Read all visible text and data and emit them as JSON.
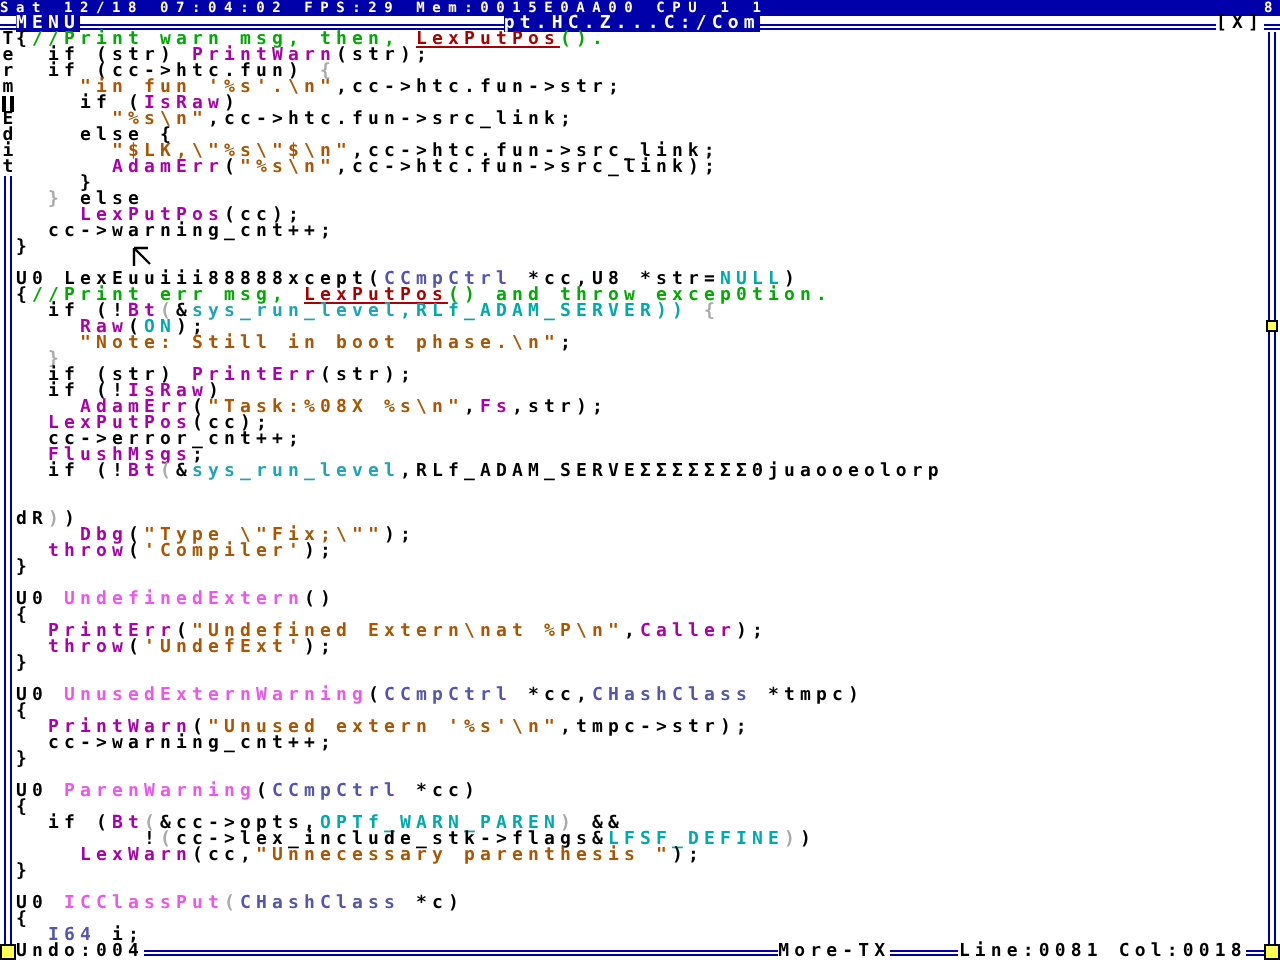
{
  "status_bar": {
    "text": "Sat 12/18 07:04:02 FPS:29 Mem:0015E0AA00 CPU 1 1",
    "corner": "8"
  },
  "window": {
    "menu": "MENU",
    "title": "pt.HC.Z...C:/Com",
    "close": "[X]"
  },
  "side_labels": [
    "Term",
    "Edit"
  ],
  "lines": [
    {
      "kind": "code",
      "tokens": [
        {
          "kind": "plain",
          "text": "{"
        },
        {
          "kind": "comment",
          "text": "//Print warn msg, then, "
        },
        {
          "kind": "link",
          "text": "LexPutPos"
        },
        {
          "kind": "comment",
          "text": "()."
        }
      ]
    },
    {
      "kind": "code",
      "tokens": [
        {
          "kind": "plain",
          "text": "  if (str) "
        },
        {
          "kind": "func",
          "text": "PrintWarn"
        },
        {
          "kind": "plain",
          "text": "(str);"
        }
      ]
    },
    {
      "kind": "code",
      "tokens": [
        {
          "kind": "plain",
          "text": "  if (cc->htc.fun) "
        },
        {
          "kind": "dim",
          "text": "{"
        }
      ]
    },
    {
      "kind": "code",
      "tokens": [
        {
          "kind": "string",
          "text": "    \"in fun '%s'.\\n\""
        },
        {
          "kind": "plain",
          "text": ",cc->htc.fun->str;"
        }
      ]
    },
    {
      "kind": "code",
      "tokens": [
        {
          "kind": "plain",
          "text": "    if ("
        },
        {
          "kind": "func",
          "text": "IsRaw"
        },
        {
          "kind": "plain",
          "text": ")"
        }
      ]
    },
    {
      "kind": "code",
      "tokens": [
        {
          "kind": "string",
          "text": "      \"%s\\n\""
        },
        {
          "kind": "plain",
          "text": ",cc->htc.fun->src_link;"
        }
      ]
    },
    {
      "kind": "code",
      "tokens": [
        {
          "kind": "plain",
          "text": "    else {"
        }
      ]
    },
    {
      "kind": "code",
      "tokens": [
        {
          "kind": "string",
          "text": "      \"$LK,\\\"%s\\\"$\\n\""
        },
        {
          "kind": "plain",
          "text": ",cc->htc.fun->src_link;"
        }
      ]
    },
    {
      "kind": "code",
      "tokens": [
        {
          "kind": "func",
          "text": "      AdamErr"
        },
        {
          "kind": "plain",
          "text": "("
        },
        {
          "kind": "string",
          "text": "\"%s\\n\""
        },
        {
          "kind": "plain",
          "text": ",cc->htc.fun->src_link);"
        }
      ]
    },
    {
      "kind": "code",
      "tokens": [
        {
          "kind": "plain",
          "text": "    }"
        }
      ]
    },
    {
      "kind": "code",
      "tokens": [
        {
          "kind": "dim",
          "text": "  }"
        },
        {
          "kind": "plain",
          "text": " else"
        }
      ]
    },
    {
      "kind": "code",
      "tokens": [
        {
          "kind": "func",
          "text": "    LexPutPos"
        },
        {
          "kind": "plain",
          "text": "(cc);"
        }
      ]
    },
    {
      "kind": "code",
      "tokens": [
        {
          "kind": "plain",
          "text": "  cc->warning_cnt++;"
        }
      ]
    },
    {
      "kind": "code",
      "tokens": [
        {
          "kind": "plain",
          "text": "}"
        }
      ]
    },
    {
      "kind": "blank"
    },
    {
      "kind": "code",
      "tokens": [
        {
          "kind": "plain",
          "text": "U0 LexEuuiii88888xcept("
        },
        {
          "kind": "type",
          "text": "CCmpCtrl"
        },
        {
          "kind": "plain",
          "text": " *cc,U8 *str="
        },
        {
          "kind": "const",
          "text": "NULL"
        },
        {
          "kind": "plain",
          "text": ")"
        }
      ]
    },
    {
      "kind": "code",
      "tokens": [
        {
          "kind": "plain",
          "text": "{"
        },
        {
          "kind": "comment",
          "text": "//Print err msg, "
        },
        {
          "kind": "link",
          "text": "LexPutPos"
        },
        {
          "kind": "comment",
          "text": "() and throw excep0tion."
        }
      ]
    },
    {
      "kind": "code",
      "tokens": [
        {
          "kind": "plain",
          "text": "  if (!"
        },
        {
          "kind": "func",
          "text": "Bt"
        },
        {
          "kind": "dim",
          "text": "("
        },
        {
          "kind": "plain",
          "text": "&"
        },
        {
          "kind": "global",
          "text": "sys_run_level"
        },
        {
          "kind": "const",
          "text": ",RLf_ADAM_SERVER))"
        },
        {
          "kind": "dim",
          "text": " {"
        }
      ]
    },
    {
      "kind": "code",
      "tokens": [
        {
          "kind": "func",
          "text": "    Raw"
        },
        {
          "kind": "plain",
          "text": "("
        },
        {
          "kind": "const",
          "text": "ON"
        },
        {
          "kind": "plain",
          "text": ");"
        }
      ]
    },
    {
      "kind": "code",
      "tokens": [
        {
          "kind": "string",
          "text": "    \"Note: Still in boot phase.\\n\""
        },
        {
          "kind": "plain",
          "text": ";"
        }
      ]
    },
    {
      "kind": "code",
      "tokens": [
        {
          "kind": "dim",
          "text": "  }"
        }
      ]
    },
    {
      "kind": "code",
      "tokens": [
        {
          "kind": "plain",
          "text": "  if (str) "
        },
        {
          "kind": "func",
          "text": "PrintErr"
        },
        {
          "kind": "plain",
          "text": "(str);"
        }
      ]
    },
    {
      "kind": "code",
      "tokens": [
        {
          "kind": "plain",
          "text": "  if (!"
        },
        {
          "kind": "func",
          "text": "IsRaw"
        },
        {
          "kind": "plain",
          "text": ")"
        }
      ]
    },
    {
      "kind": "code",
      "tokens": [
        {
          "kind": "func",
          "text": "    AdamErr"
        },
        {
          "kind": "plain",
          "text": "("
        },
        {
          "kind": "string",
          "text": "\"Task:%08X %s\\n\""
        },
        {
          "kind": "plain",
          "text": ","
        },
        {
          "kind": "func",
          "text": "Fs"
        },
        {
          "kind": "plain",
          "text": ",str);"
        }
      ]
    },
    {
      "kind": "code",
      "tokens": [
        {
          "kind": "func",
          "text": "  LexPutPos"
        },
        {
          "kind": "plain",
          "text": "(cc);"
        }
      ]
    },
    {
      "kind": "code",
      "tokens": [
        {
          "kind": "plain",
          "text": "  cc->error_cnt++;"
        }
      ]
    },
    {
      "kind": "code",
      "tokens": [
        {
          "kind": "func",
          "text": "  FlushMsgs"
        },
        {
          "kind": "plain",
          "text": ";"
        }
      ]
    },
    {
      "kind": "code",
      "tokens": [
        {
          "kind": "plain",
          "text": "  if (!"
        },
        {
          "kind": "func",
          "text": "Bt"
        },
        {
          "kind": "dim",
          "text": "("
        },
        {
          "kind": "plain",
          "text": "&"
        },
        {
          "kind": "global",
          "text": "sys_run_level"
        },
        {
          "kind": "plain",
          "text": ",RLf_ADAM_SERVEΣΣΣΣΣΣΣΘjuaooeolorp"
        }
      ]
    },
    {
      "kind": "blank"
    },
    {
      "kind": "blank"
    },
    {
      "kind": "code",
      "tokens": [
        {
          "kind": "plain",
          "text": "dR"
        },
        {
          "kind": "dim",
          "text": ")"
        },
        {
          "kind": "plain",
          "text": ")"
        }
      ]
    },
    {
      "kind": "code",
      "tokens": [
        {
          "kind": "func",
          "text": "    Dbg"
        },
        {
          "kind": "plain",
          "text": "("
        },
        {
          "kind": "string",
          "text": "\"Type \\\"Fix;\\\"\""
        },
        {
          "kind": "plain",
          "text": ");"
        }
      ]
    },
    {
      "kind": "code",
      "tokens": [
        {
          "kind": "func",
          "text": "  throw"
        },
        {
          "kind": "plain",
          "text": "("
        },
        {
          "kind": "string",
          "text": "'Compiler'"
        },
        {
          "kind": "plain",
          "text": ");"
        }
      ]
    },
    {
      "kind": "code",
      "tokens": [
        {
          "kind": "plain",
          "text": "}"
        }
      ]
    },
    {
      "kind": "blank"
    },
    {
      "kind": "code",
      "tokens": [
        {
          "kind": "plain",
          "text": "U0 "
        },
        {
          "kind": "fundef",
          "text": "UndefinedExtern"
        },
        {
          "kind": "plain",
          "text": "()"
        }
      ]
    },
    {
      "kind": "code",
      "tokens": [
        {
          "kind": "plain",
          "text": "{"
        }
      ]
    },
    {
      "kind": "code",
      "tokens": [
        {
          "kind": "func",
          "text": "  PrintErr"
        },
        {
          "kind": "plain",
          "text": "("
        },
        {
          "kind": "string",
          "text": "\"Undefined Extern\\nat %P\\n\""
        },
        {
          "kind": "plain",
          "text": ","
        },
        {
          "kind": "func",
          "text": "Caller"
        },
        {
          "kind": "plain",
          "text": ");"
        }
      ]
    },
    {
      "kind": "code",
      "tokens": [
        {
          "kind": "func",
          "text": "  throw"
        },
        {
          "kind": "plain",
          "text": "("
        },
        {
          "kind": "string",
          "text": "'UndefExt'"
        },
        {
          "kind": "plain",
          "text": ");"
        }
      ]
    },
    {
      "kind": "code",
      "tokens": [
        {
          "kind": "plain",
          "text": "}"
        }
      ]
    },
    {
      "kind": "blank"
    },
    {
      "kind": "code",
      "tokens": [
        {
          "kind": "plain",
          "text": "U0 "
        },
        {
          "kind": "fundef",
          "text": "UnusedExternWarning"
        },
        {
          "kind": "plain",
          "text": "("
        },
        {
          "kind": "type",
          "text": "CCmpCtrl"
        },
        {
          "kind": "plain",
          "text": " *cc,"
        },
        {
          "kind": "type",
          "text": "CHashClass"
        },
        {
          "kind": "plain",
          "text": " *tmpc)"
        }
      ]
    },
    {
      "kind": "code",
      "tokens": [
        {
          "kind": "plain",
          "text": "{"
        }
      ]
    },
    {
      "kind": "code",
      "tokens": [
        {
          "kind": "func",
          "text": "  PrintWarn"
        },
        {
          "kind": "plain",
          "text": "("
        },
        {
          "kind": "string",
          "text": "\"Unused extern '%s'\\n\""
        },
        {
          "kind": "plain",
          "text": ",tmpc->str);"
        }
      ]
    },
    {
      "kind": "code",
      "tokens": [
        {
          "kind": "plain",
          "text": "  cc->warning_cnt++;"
        }
      ]
    },
    {
      "kind": "code",
      "tokens": [
        {
          "kind": "plain",
          "text": "}"
        }
      ]
    },
    {
      "kind": "blank"
    },
    {
      "kind": "code",
      "tokens": [
        {
          "kind": "plain",
          "text": "U0 "
        },
        {
          "kind": "fundef",
          "text": "ParenWarning"
        },
        {
          "kind": "plain",
          "text": "("
        },
        {
          "kind": "type",
          "text": "CCmpCtrl"
        },
        {
          "kind": "plain",
          "text": " *cc)"
        }
      ]
    },
    {
      "kind": "code",
      "tokens": [
        {
          "kind": "plain",
          "text": "{"
        }
      ]
    },
    {
      "kind": "code",
      "tokens": [
        {
          "kind": "plain",
          "text": "  if ("
        },
        {
          "kind": "func",
          "text": "Bt"
        },
        {
          "kind": "dim",
          "text": "("
        },
        {
          "kind": "plain",
          "text": "&cc->opts,"
        },
        {
          "kind": "const",
          "text": "OPTf_WARN_PAREN"
        },
        {
          "kind": "dim",
          "text": ")"
        },
        {
          "kind": "plain",
          "text": " &&"
        }
      ]
    },
    {
      "kind": "code",
      "tokens": [
        {
          "kind": "plain",
          "text": "        !"
        },
        {
          "kind": "dim",
          "text": "("
        },
        {
          "kind": "plain",
          "text": "cc->lex_include_stk->flags&"
        },
        {
          "kind": "const",
          "text": "LFSF_DEFINE"
        },
        {
          "kind": "dim",
          "text": ")"
        },
        {
          "kind": "plain",
          "text": ")"
        }
      ]
    },
    {
      "kind": "code",
      "tokens": [
        {
          "kind": "func",
          "text": "    LexWarn"
        },
        {
          "kind": "plain",
          "text": "(cc,"
        },
        {
          "kind": "string",
          "text": "\"Unnecessary parenthesis \""
        },
        {
          "kind": "plain",
          "text": ");"
        }
      ]
    },
    {
      "kind": "code",
      "tokens": [
        {
          "kind": "plain",
          "text": "}"
        }
      ]
    },
    {
      "kind": "blank"
    },
    {
      "kind": "code",
      "tokens": [
        {
          "kind": "plain",
          "text": "U0 "
        },
        {
          "kind": "fundef",
          "text": "ICClassPut"
        },
        {
          "kind": "dim",
          "text": "("
        },
        {
          "kind": "type",
          "text": "CHashClass"
        },
        {
          "kind": "plain",
          "text": " *c)"
        }
      ]
    },
    {
      "kind": "code",
      "tokens": [
        {
          "kind": "plain",
          "text": "{"
        }
      ]
    },
    {
      "kind": "code",
      "tokens": [
        {
          "kind": "type",
          "text": "  I64"
        },
        {
          "kind": "plain",
          "text": " i;"
        }
      ]
    }
  ],
  "footer": {
    "undo": "Undo:004",
    "mode": "More-TX",
    "position": "Line:0081 Col:0018"
  }
}
